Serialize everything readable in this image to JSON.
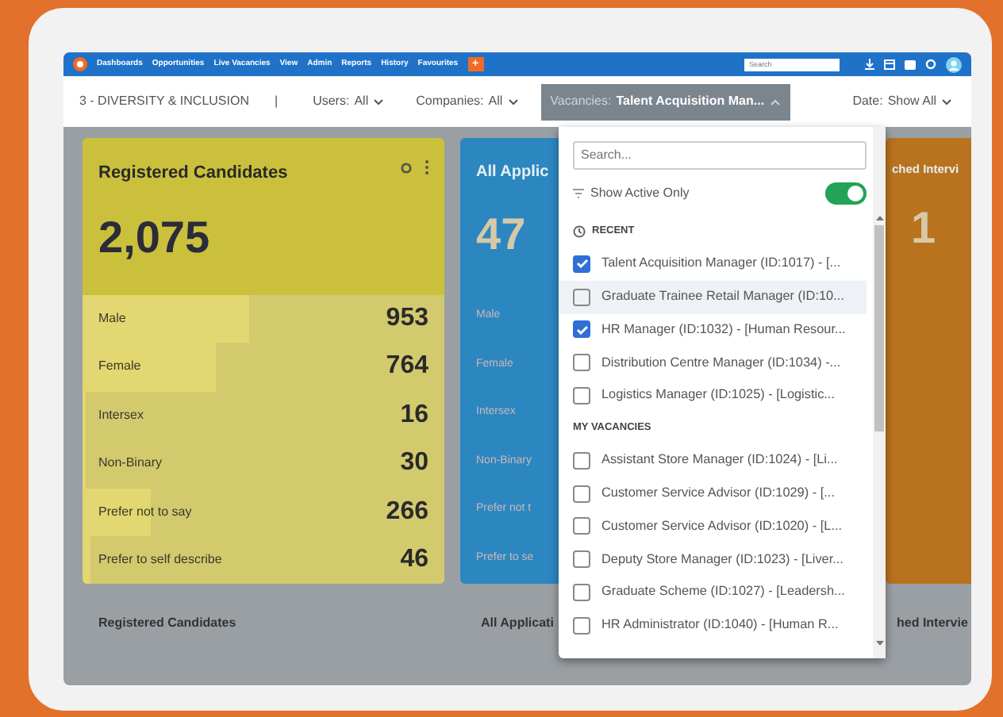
{
  "nav": {
    "menu": [
      "Dashboards",
      "Opportunities",
      "Live Vacancies",
      "View",
      "Admin",
      "Reports",
      "History",
      "Favourites"
    ],
    "add_button": "+",
    "search": {
      "placeholder": "Search"
    }
  },
  "filters": {
    "report": "3 - DIVERSITY & INCLUSION",
    "separator": "|",
    "items": [
      {
        "label": "Users:",
        "value": "All",
        "open": false
      },
      {
        "label": "Companies:",
        "value": "All",
        "open": false
      },
      {
        "label": "Vacancies:",
        "value": "Talent Acquisition Man...",
        "open": true
      },
      {
        "label": "Date:",
        "value": "Show All",
        "open": false
      }
    ]
  },
  "cards": [
    {
      "title": "Registered Candidates",
      "total": "2,075",
      "color": "#cbc03c",
      "rows": [
        {
          "label": "Male",
          "value": "953",
          "level": 0.46
        },
        {
          "label": "Female",
          "value": "764",
          "level": 0.37
        },
        {
          "label": "Intersex",
          "value": "16",
          "level": 0.01
        },
        {
          "label": "Non-Binary",
          "value": "30",
          "level": 0.01
        },
        {
          "label": "Prefer not to say",
          "value": "266",
          "level": 0.19
        },
        {
          "label": "Prefer to self describe",
          "value": "46",
          "level": 0.02
        }
      ]
    },
    {
      "title": "All Applic",
      "total": "47",
      "color": "#2c87c1",
      "rows": [
        {
          "label": "Male"
        },
        {
          "label": "Female"
        },
        {
          "label": "Intersex"
        },
        {
          "label": "Non-Binary"
        },
        {
          "label": "Prefer not t"
        },
        {
          "label": "Prefer to se"
        }
      ]
    },
    {
      "title": "ched Intervi",
      "total": "1",
      "color": "#b9731f"
    }
  ],
  "footer": [
    "Registered Candidates",
    "All Applicati",
    "hed Intervie"
  ],
  "dropdown": {
    "search": {
      "placeholder": "Search..."
    },
    "toggle": {
      "label": "Show Active Only",
      "on": true
    },
    "sections": [
      {
        "kind": "recent",
        "heading": "RECENT",
        "items": [
          {
            "label": "Talent Acquisition Manager (ID:1017) - [...",
            "checked": true,
            "highlighted": false
          },
          {
            "label": "Graduate Trainee Retail Manager (ID:10...",
            "checked": false,
            "highlighted": true
          },
          {
            "label": "HR Manager (ID:1032) - [Human Resour...",
            "checked": true,
            "highlighted": false
          },
          {
            "label": "Distribution Centre Manager (ID:1034) -...",
            "checked": false,
            "highlighted": false
          },
          {
            "label": "Logistics Manager (ID:1025) - [Logistic...",
            "checked": false,
            "highlighted": false
          }
        ]
      },
      {
        "kind": "mine",
        "heading": "MY VACANCIES",
        "items": [
          {
            "label": "Assistant Store Manager (ID:1024) - [Li...",
            "checked": false,
            "highlighted": false
          },
          {
            "label": "Customer Service Advisor (ID:1029) - [...",
            "checked": false,
            "highlighted": false
          },
          {
            "label": "Customer Service Advisor (ID:1020) - [L...",
            "checked": false,
            "highlighted": false
          },
          {
            "label": "Deputy Store Manager (ID:1023) - [Liver...",
            "checked": false,
            "highlighted": false
          },
          {
            "label": "Graduate Scheme (ID:1027) - [Leadersh...",
            "checked": false,
            "highlighted": false
          },
          {
            "label": "HR Administrator (ID:1040) - [Human R...",
            "checked": false,
            "highlighted": false
          }
        ]
      }
    ]
  }
}
